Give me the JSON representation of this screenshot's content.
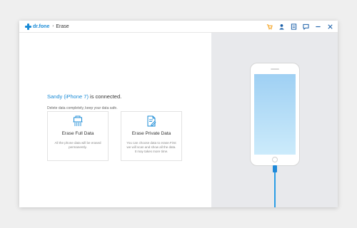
{
  "app": {
    "brand": "dr.fone",
    "crumb_separator": "›",
    "section": "Erase",
    "accent_color": "#1a8bd6"
  },
  "title_icons": [
    "cart-icon",
    "account-icon",
    "feedback-icon",
    "chat-icon",
    "minimize-icon",
    "close-icon"
  ],
  "main": {
    "device_name": "Sandy (iPhone 7)",
    "connected_text": " is connected.",
    "subtext": "Delete data completely, keep your data safe.",
    "cards": [
      {
        "icon": "shredder-icon",
        "title": "Erase Full Data",
        "description": "All the phone data will be erased permanently."
      },
      {
        "icon": "document-edit-icon",
        "title": "Erase Private Data",
        "description": "You can choose data to erase.First we will scan and show all the data. It may takes more time."
      }
    ]
  },
  "device_panel": {
    "screen_color_top": "#9fd0f3",
    "screen_color_bottom": "#ccebfb",
    "cable_color": "#2a9de6"
  }
}
